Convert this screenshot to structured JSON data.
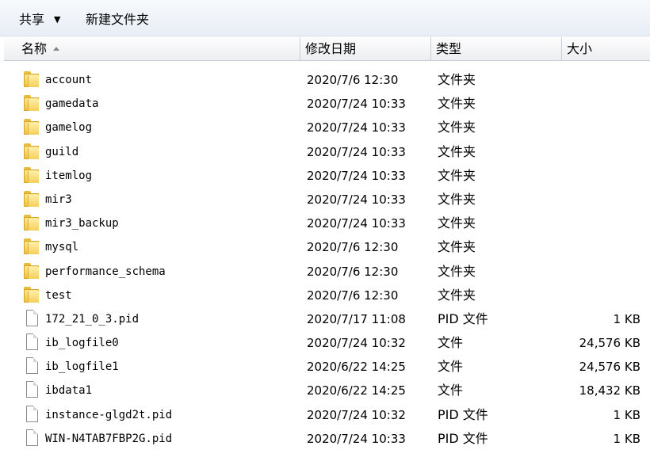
{
  "toolbar": {
    "share": "共享",
    "new_folder": "新建文件夹"
  },
  "columns": {
    "name": "名称",
    "date": "修改日期",
    "type": "类型",
    "size": "大小"
  },
  "files": [
    {
      "name": "account",
      "date": "2020/7/6 12:30",
      "type": "文件夹",
      "size": "",
      "icon": "folder-icon"
    },
    {
      "name": "gamedata",
      "date": "2020/7/24 10:33",
      "type": "文件夹",
      "size": "",
      "icon": "folder-icon"
    },
    {
      "name": "gamelog",
      "date": "2020/7/24 10:33",
      "type": "文件夹",
      "size": "",
      "icon": "folder-icon"
    },
    {
      "name": "guild",
      "date": "2020/7/24 10:33",
      "type": "文件夹",
      "size": "",
      "icon": "folder-icon"
    },
    {
      "name": "itemlog",
      "date": "2020/7/24 10:33",
      "type": "文件夹",
      "size": "",
      "icon": "folder-icon"
    },
    {
      "name": "mir3",
      "date": "2020/7/24 10:33",
      "type": "文件夹",
      "size": "",
      "icon": "folder-icon"
    },
    {
      "name": "mir3_backup",
      "date": "2020/7/24 10:33",
      "type": "文件夹",
      "size": "",
      "icon": "folder-icon"
    },
    {
      "name": "mysql",
      "date": "2020/7/6 12:30",
      "type": "文件夹",
      "size": "",
      "icon": "folder-icon"
    },
    {
      "name": "performance_schema",
      "date": "2020/7/6 12:30",
      "type": "文件夹",
      "size": "",
      "icon": "folder-icon"
    },
    {
      "name": "test",
      "date": "2020/7/6 12:30",
      "type": "文件夹",
      "size": "",
      "icon": "folder-icon"
    },
    {
      "name": "172_21_0_3.pid",
      "date": "2020/7/17 11:08",
      "type": "PID 文件",
      "size": "1 KB",
      "icon": "file-icon"
    },
    {
      "name": "ib_logfile0",
      "date": "2020/7/24 10:32",
      "type": "文件",
      "size": "24,576 KB",
      "icon": "file-icon"
    },
    {
      "name": "ib_logfile1",
      "date": "2020/6/22 14:25",
      "type": "文件",
      "size": "24,576 KB",
      "icon": "file-icon"
    },
    {
      "name": "ibdata1",
      "date": "2020/6/22 14:25",
      "type": "文件",
      "size": "18,432 KB",
      "icon": "file-icon"
    },
    {
      "name": "instance-glgd2t.pid",
      "date": "2020/7/24 10:32",
      "type": "PID 文件",
      "size": "1 KB",
      "icon": "file-icon"
    },
    {
      "name": "WIN-N4TAB7FBP2G.pid",
      "date": "2020/7/24 10:33",
      "type": "PID 文件",
      "size": "1 KB",
      "icon": "file-icon"
    }
  ]
}
